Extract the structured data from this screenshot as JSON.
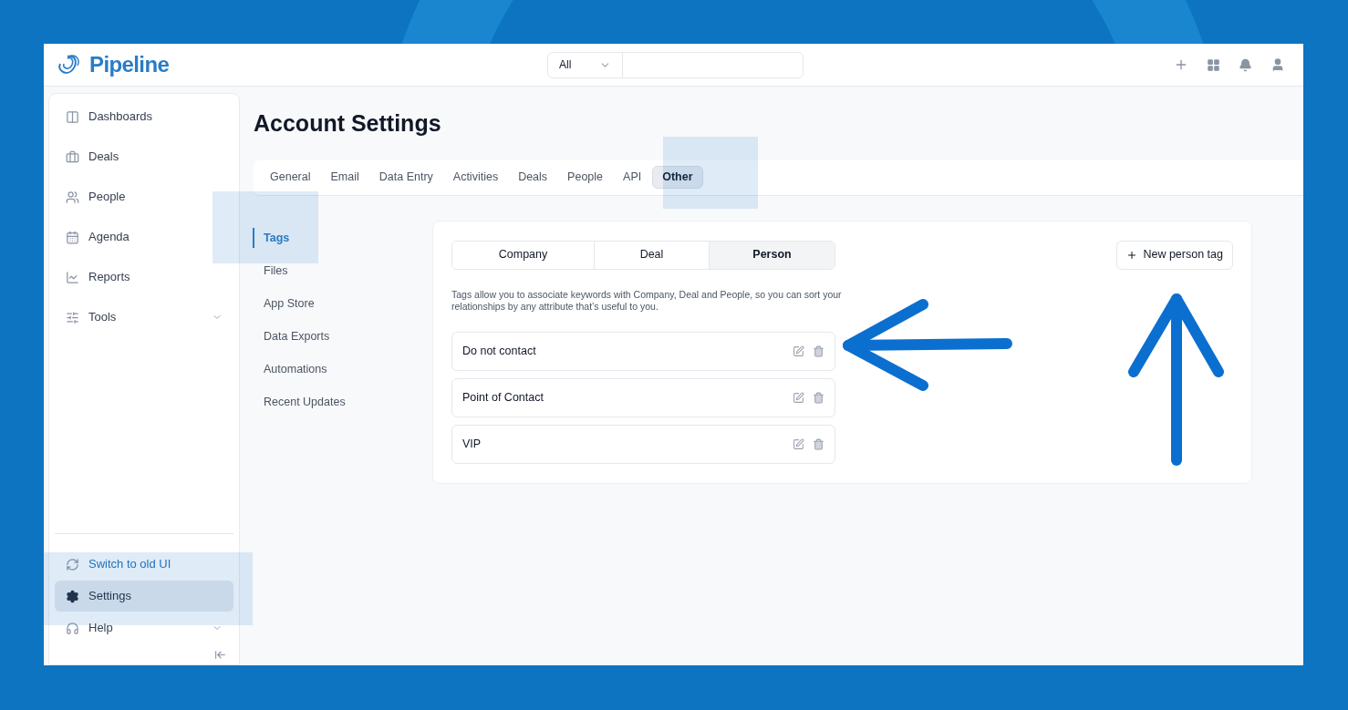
{
  "header": {
    "logo": "Pipeline",
    "search": {
      "filter": "All"
    }
  },
  "sidebar": {
    "items": [
      {
        "label": "Dashboards",
        "selected": false,
        "expandable": false
      },
      {
        "label": "Deals",
        "selected": false,
        "expandable": false
      },
      {
        "label": "People",
        "selected": false,
        "expandable": false
      },
      {
        "label": "Agenda",
        "selected": false,
        "expandable": false
      },
      {
        "label": "Reports",
        "selected": false,
        "expandable": false
      },
      {
        "label": "Tools",
        "selected": false,
        "expandable": true
      }
    ],
    "bottom_items": [
      {
        "label": "Switch to old UI",
        "kind": "link",
        "selected": false,
        "expandable": false
      },
      {
        "label": "Settings",
        "kind": "item",
        "selected": true,
        "expandable": false
      },
      {
        "label": "Help",
        "kind": "item",
        "selected": false,
        "expandable": true
      }
    ]
  },
  "title": "Account Settings",
  "tabs": [
    {
      "label": "General",
      "selected": false
    },
    {
      "label": "Email",
      "selected": false
    },
    {
      "label": "Data Entry",
      "selected": false
    },
    {
      "label": "Activities",
      "selected": false
    },
    {
      "label": "Deals",
      "selected": false
    },
    {
      "label": "People",
      "selected": false
    },
    {
      "label": "API",
      "selected": false
    },
    {
      "label": "Other",
      "selected": true
    }
  ],
  "subnav": [
    {
      "label": "Tags",
      "selected": true
    },
    {
      "label": "Files",
      "selected": false
    },
    {
      "label": "App Store",
      "selected": false
    },
    {
      "label": "Data Exports",
      "selected": false
    },
    {
      "label": "Automations",
      "selected": false
    },
    {
      "label": "Recent Updates",
      "selected": false
    }
  ],
  "segments": [
    {
      "label": "Company",
      "selected": false
    },
    {
      "label": "Deal",
      "selected": false
    },
    {
      "label": "Person",
      "selected": true
    }
  ],
  "new_tag_button": "New person tag",
  "description": "Tags allow you to associate keywords with Company, Deal and People, so you can sort your relationships by any attribute that’s useful to you.",
  "tags": [
    {
      "name": "Do not contact"
    },
    {
      "name": "Point of Contact"
    },
    {
      "name": "VIP"
    }
  ]
}
